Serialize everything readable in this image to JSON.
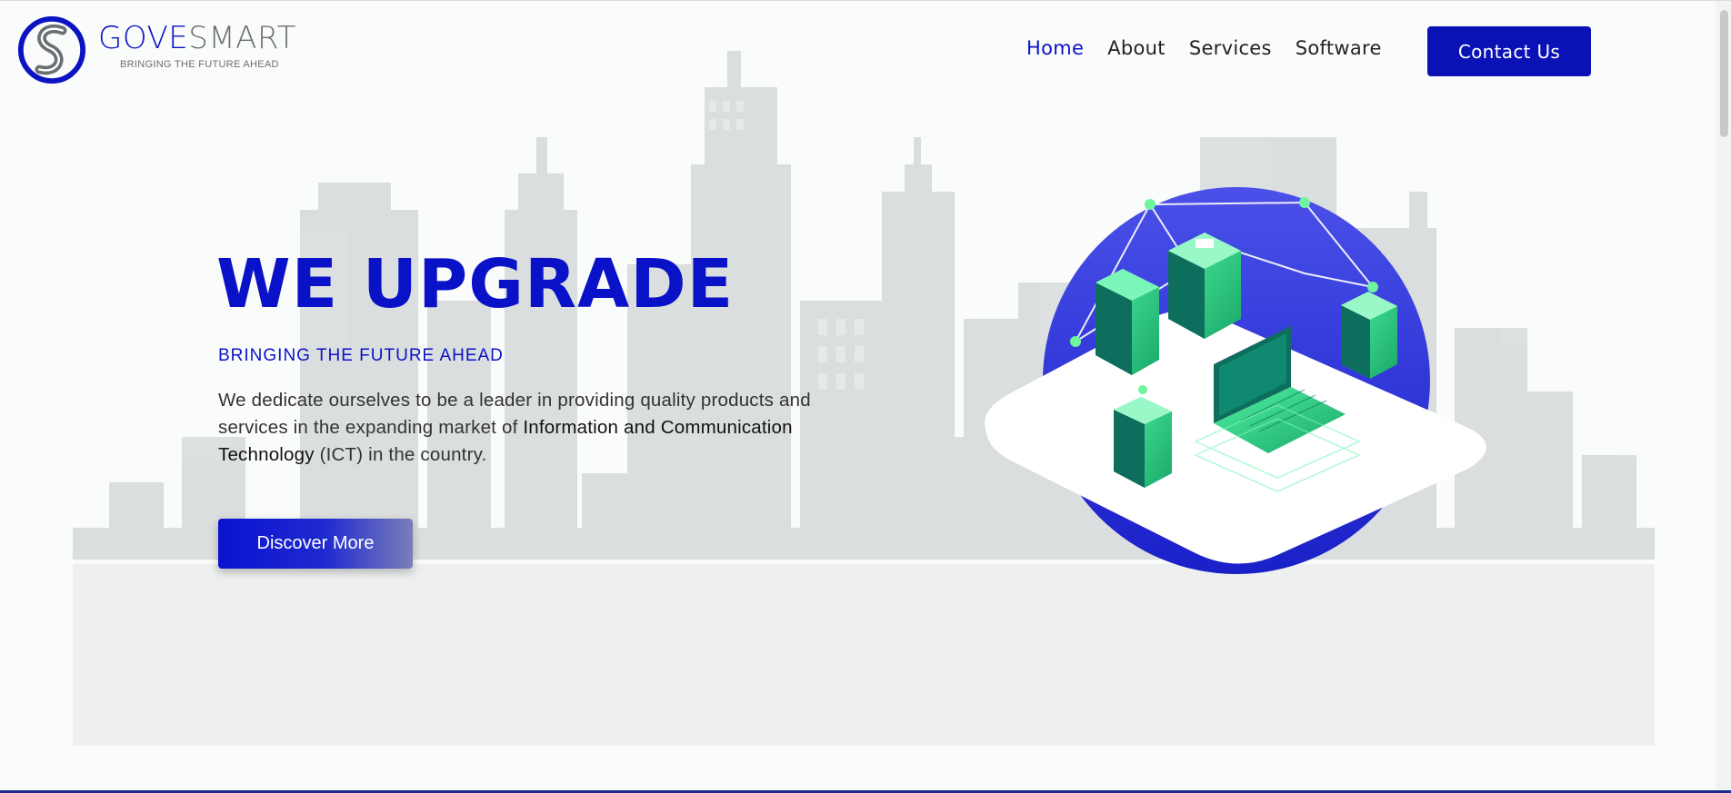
{
  "brand": {
    "name_part1": "GOVE",
    "name_part2": "SMART",
    "tagline": "BRINGING THE FUTURE AHEAD"
  },
  "nav": {
    "items": [
      {
        "label": "Home",
        "active": true
      },
      {
        "label": "About",
        "active": false
      },
      {
        "label": "Services",
        "active": false
      },
      {
        "label": "Software",
        "active": false
      }
    ],
    "contact_label": "Contact Us"
  },
  "hero": {
    "title": "WE UPGRADE",
    "subtitle": "BRINGING THE FUTURE AHEAD",
    "description_part1": "We dedicate ourselves to be a leader in providing quality products and services in the expanding market of ",
    "description_bold": "Information and Communication Technology",
    "description_part2": " (ICT) in the country.",
    "cta_label": "Discover More"
  },
  "colors": {
    "brand_blue": "#0a12c8",
    "button_blue": "#0a12b6",
    "accent_green": "#3ee08a",
    "skyline_gray": "#d4d8d8"
  },
  "icons": {
    "logo": "s-swirl-logo",
    "illustration": "isometric-server-network"
  }
}
